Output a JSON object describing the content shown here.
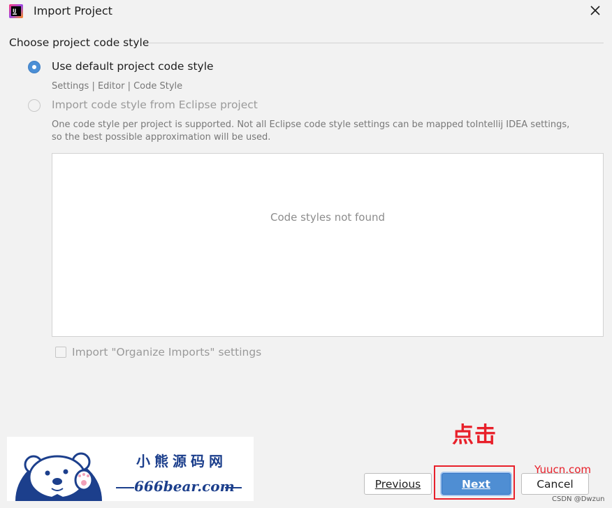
{
  "window": {
    "title": "Import Project"
  },
  "section": {
    "title": "Choose project code style"
  },
  "options": {
    "default_style": {
      "label": "Use default project code style",
      "path": "Settings | Editor | Code Style",
      "selected": true
    },
    "eclipse_style": {
      "label": "Import code style from Eclipse project",
      "hint_line1": "One code style per project is supported. Not all Eclipse code style settings can be mapped toIntellij IDEA settings,",
      "hint_line2": "so the best possible approximation will be used.",
      "selected": false
    }
  },
  "code_styles_list": {
    "empty_text": "Code styles not found"
  },
  "organize_imports": {
    "label": "Import \"Organize Imports\" settings",
    "checked": false
  },
  "buttons": {
    "previous_label": "Previous",
    "next_label": "Next",
    "cancel_label": "Cancel"
  },
  "annotation": {
    "text": "点击"
  },
  "watermark": {
    "banner_title": "小熊源码网",
    "banner_url": "666bear.com",
    "yuucn": "Yuucn.com",
    "csdn": "CSDN @Dwzun"
  },
  "colors": {
    "accent": "#4f8ed3",
    "annotation_red": "#e8202a",
    "banner_blue": "#1c3f8c"
  }
}
